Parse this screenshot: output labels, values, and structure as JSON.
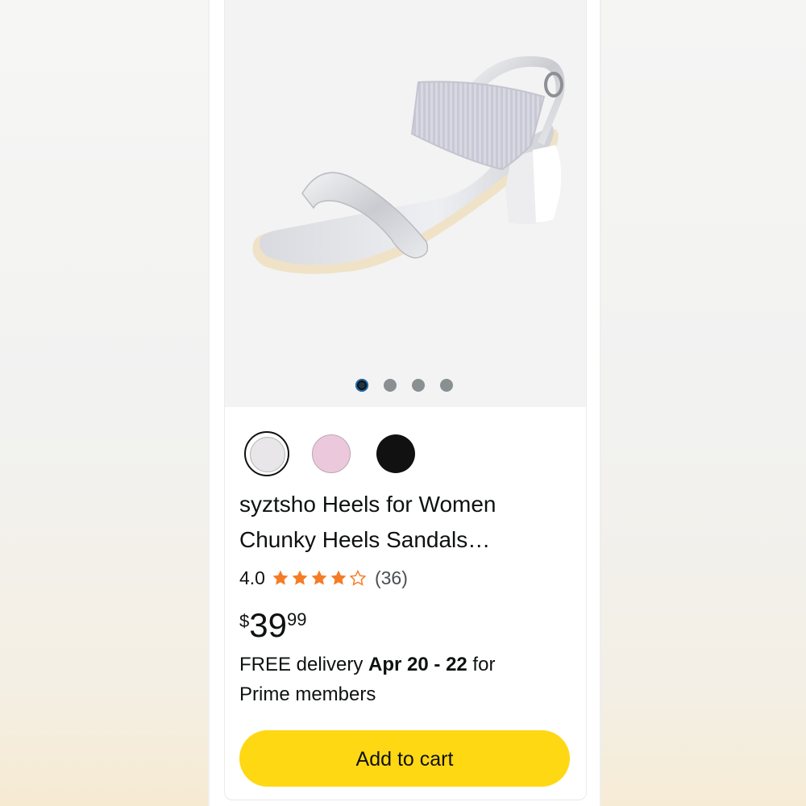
{
  "product": {
    "title_line1": "syztsho Heels for Women",
    "title_line2": "Chunky Heels Sandals…",
    "rating": "4.0",
    "rating_value": 4.0,
    "rating_max": 5,
    "review_count": "(36)",
    "price_symbol": "$",
    "price_whole": "39",
    "price_fraction": "99"
  },
  "gallery": {
    "image_count": 4,
    "active_index": 0,
    "image_icon": "silver-heeled-sandal"
  },
  "swatches": [
    {
      "name": "silver",
      "color": "#e8e6e8",
      "selected": true
    },
    {
      "name": "pink",
      "color": "#ecc8dd",
      "selected": false
    },
    {
      "name": "black",
      "color": "#111111",
      "selected": false
    }
  ],
  "delivery": {
    "prefix": "FREE delivery ",
    "dates": "Apr 20 - 22",
    "suffix_line1": " for",
    "line2": "Prime members"
  },
  "actions": {
    "add_to_cart": "Add to cart"
  },
  "colors": {
    "button": "#ffd814",
    "star": "#f57c24",
    "text": "#0f1111"
  }
}
